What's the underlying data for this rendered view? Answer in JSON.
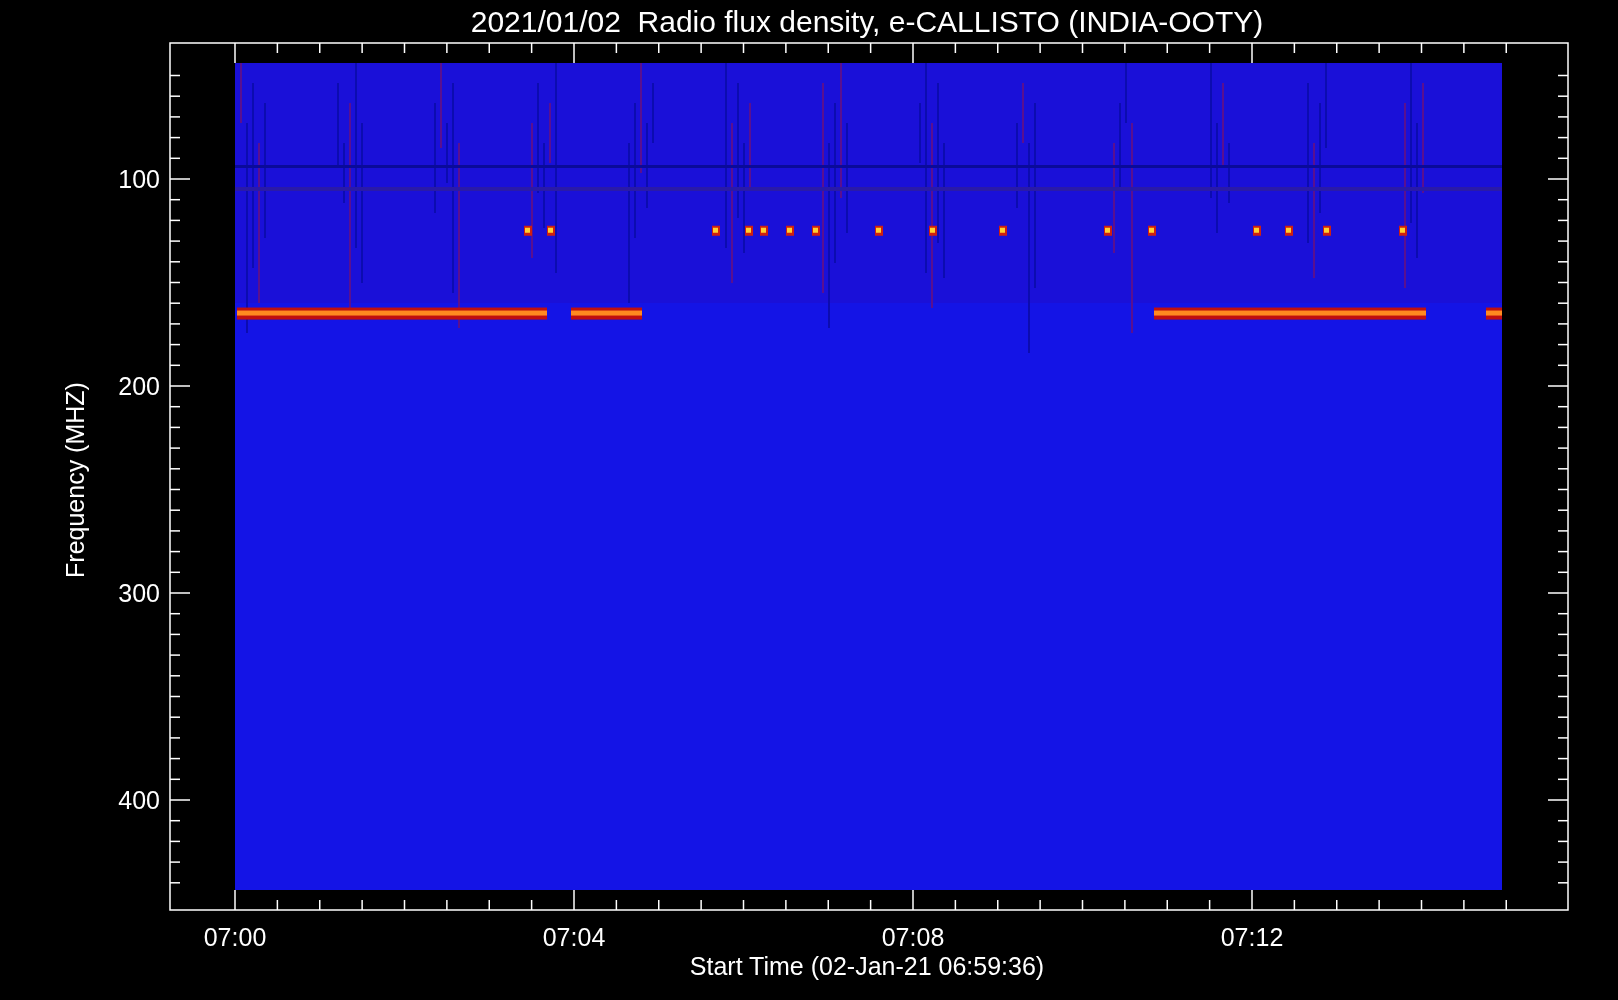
{
  "title": "2021/01/02  Radio flux density, e-CALLISTO (INDIA-OOTY)",
  "ylabel": "Frequency (MHZ)",
  "xlabel": "Start Time (02-Jan-21 06:59:36)",
  "yticks": [
    "100",
    "200",
    "300",
    "400"
  ],
  "xticks": [
    "07:00",
    "07:04",
    "07:08",
    "07:12"
  ]
}
